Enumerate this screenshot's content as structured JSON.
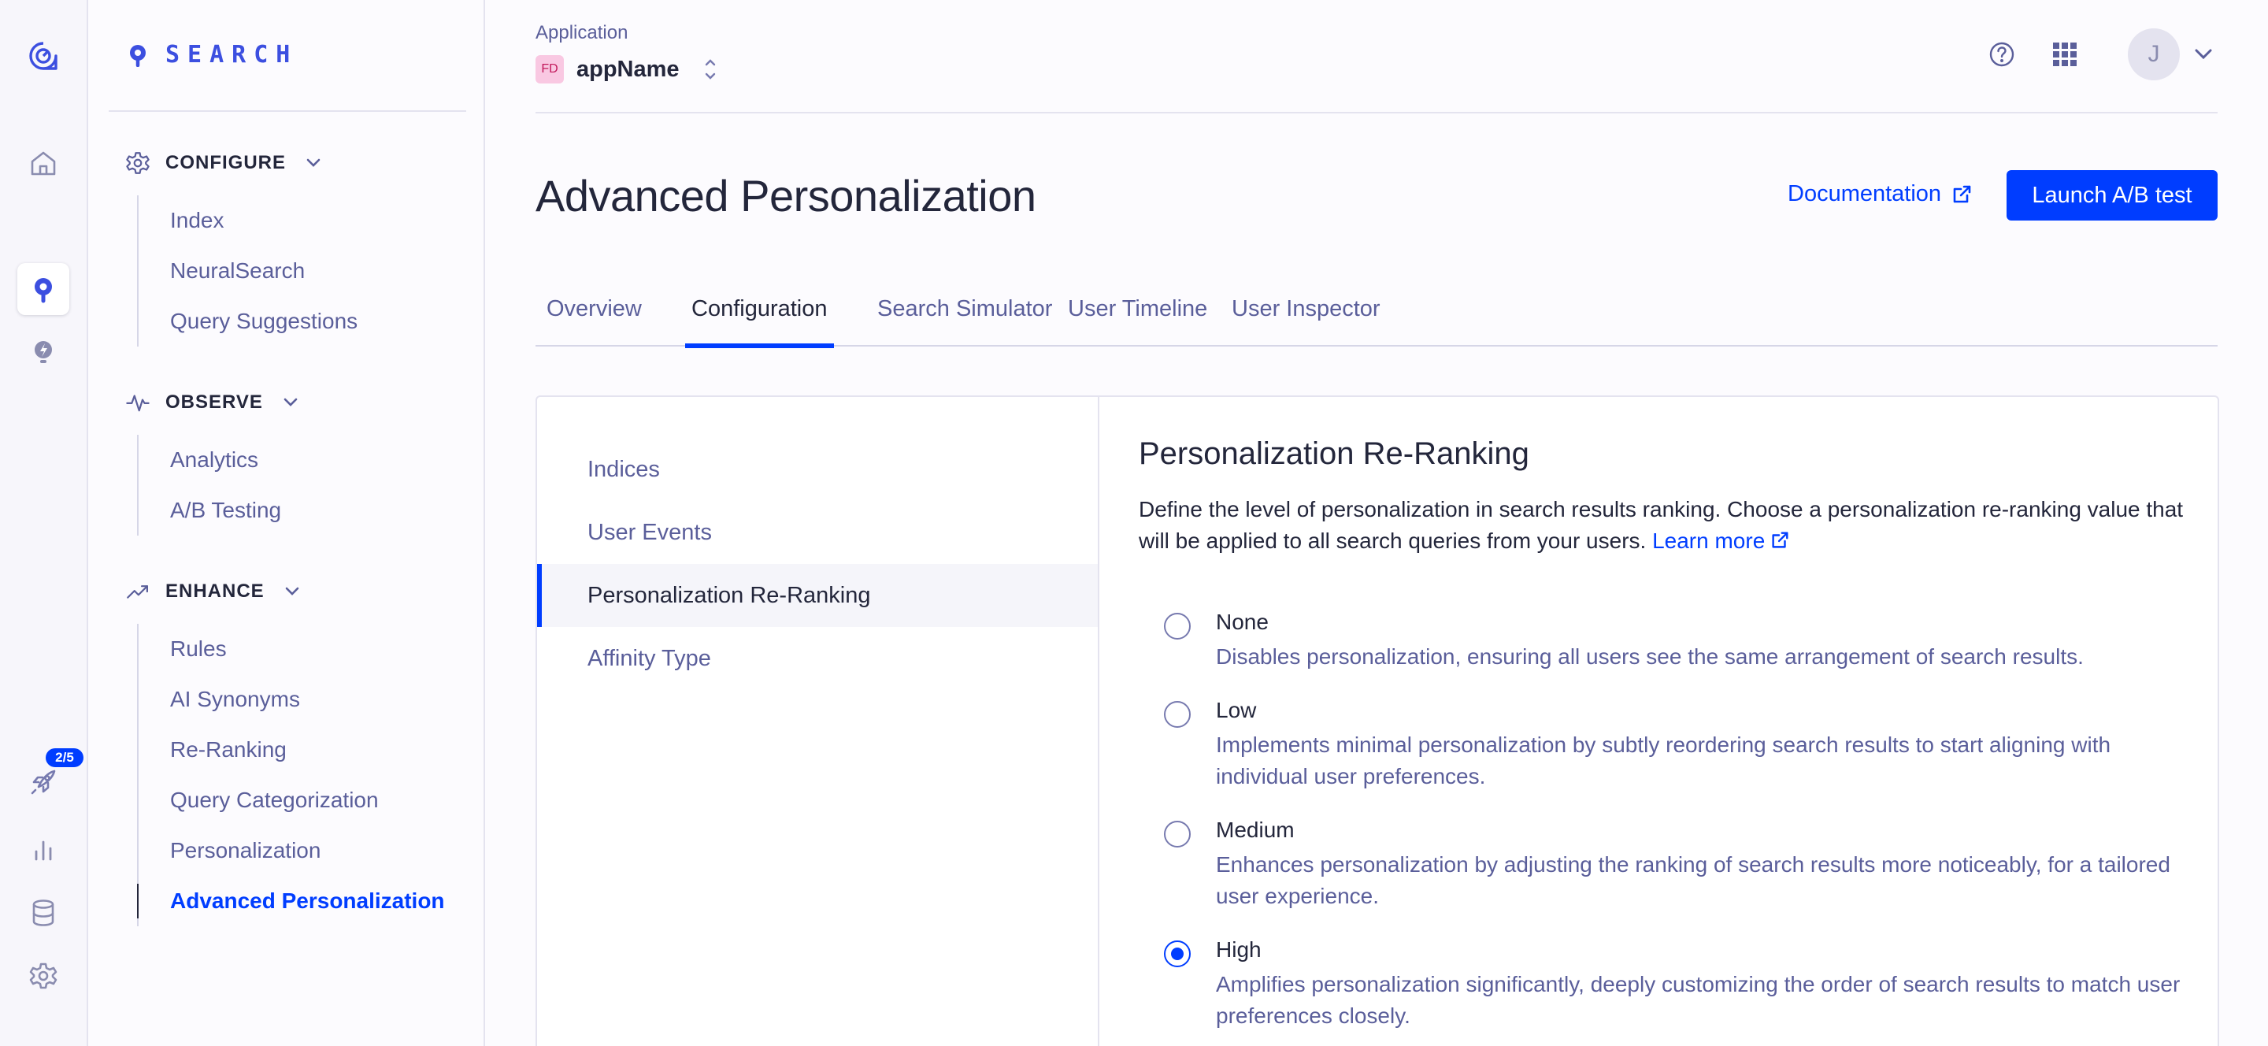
{
  "rail": {
    "badge": "2/5",
    "icons": [
      "algolia-logo-icon",
      "home-icon",
      "search-product-icon",
      "bulb-icon",
      "rocket-icon",
      "bar-chart-icon",
      "database-icon",
      "settings-icon"
    ]
  },
  "nav": {
    "brand": "SEARCH",
    "sections": [
      {
        "label": "CONFIGURE",
        "items": [
          "Index",
          "NeuralSearch",
          "Query Suggestions"
        ]
      },
      {
        "label": "OBSERVE",
        "items": [
          "Analytics",
          "A/B Testing"
        ]
      },
      {
        "label": "ENHANCE",
        "items": [
          "Rules",
          "AI Synonyms",
          "Re-Ranking",
          "Query Categorization",
          "Personalization",
          "Advanced Personalization"
        ]
      }
    ],
    "active_item": "Advanced Personalization"
  },
  "header": {
    "app_caption": "Application",
    "app_badge": "FD",
    "app_name": "appName",
    "avatar_initial": "J"
  },
  "page": {
    "title": "Advanced Personalization",
    "documentation_label": "Documentation",
    "launch_button": "Launch A/B test"
  },
  "tabs": [
    {
      "label": "Overview",
      "active": false
    },
    {
      "label": "Configuration",
      "active": true
    },
    {
      "label": "Search Simulator",
      "active": false
    },
    {
      "label": "User Timeline",
      "active": false
    },
    {
      "label": "User Inspector",
      "active": false
    }
  ],
  "side_menu": [
    {
      "label": "Indices",
      "active": false
    },
    {
      "label": "User Events",
      "active": false
    },
    {
      "label": "Personalization Re-Ranking",
      "active": true
    },
    {
      "label": "Affinity Type",
      "active": false
    }
  ],
  "section": {
    "title": "Personalization Re-Ranking",
    "description": "Define the level of personalization in search results ranking. Choose a personalization re-ranking value that will be applied to all search queries from your users.",
    "learn_more": "Learn more",
    "options": [
      {
        "title": "None",
        "description": "Disables personalization, ensuring all users see the same arrangement of search results.",
        "checked": false
      },
      {
        "title": "Low",
        "description": "Implements minimal personalization by subtly reordering search results to start aligning with individual user preferences.",
        "checked": false
      },
      {
        "title": "Medium",
        "description": "Enhances personalization by adjusting the ranking of search results more noticeably, for a tailored user experience.",
        "checked": false
      },
      {
        "title": "High",
        "description": "Amplifies personalization significantly, deeply customizing the order of search results to match user preferences closely.",
        "checked": true
      }
    ]
  },
  "colors": {
    "accent": "#003dff",
    "text": "#23263b",
    "muted": "#5a5e9a",
    "border": "#e4e3ef"
  }
}
